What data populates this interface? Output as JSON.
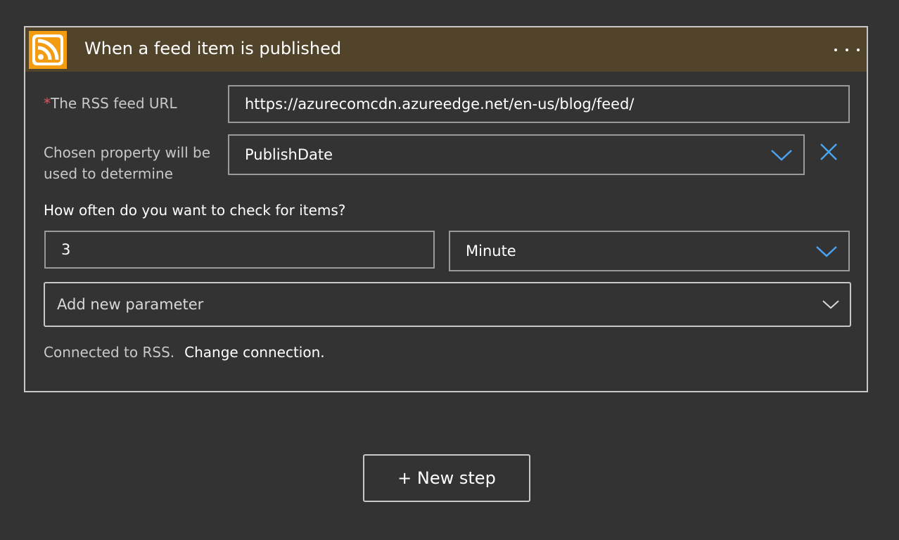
{
  "trigger": {
    "title": "When a feed item is published",
    "more_icon": "ellipsis-icon",
    "brand_icon": "rss-icon",
    "brand_color": "#f39c12",
    "header_color": "#52432b"
  },
  "fields": {
    "feed_url": {
      "required_mark": "*",
      "label": "The RSS feed URL",
      "value": "https://azurecomcdn.azureedge.net/en-us/blog/feed/"
    },
    "chosen_property": {
      "label_line1": "Chosen property will be",
      "label_line2": "used to determine",
      "value": "PublishDate"
    },
    "frequency": {
      "question": "How often do you want to check for items?",
      "interval": "3",
      "unit": "Minute"
    },
    "add_param": {
      "placeholder": "Add new parameter"
    }
  },
  "connection": {
    "status": "Connected to RSS.",
    "change_link": "Change connection."
  },
  "actions": {
    "new_step": "+ New step"
  },
  "colors": {
    "accent_chevron": "#4aa3f0",
    "required": "#e0565b"
  }
}
